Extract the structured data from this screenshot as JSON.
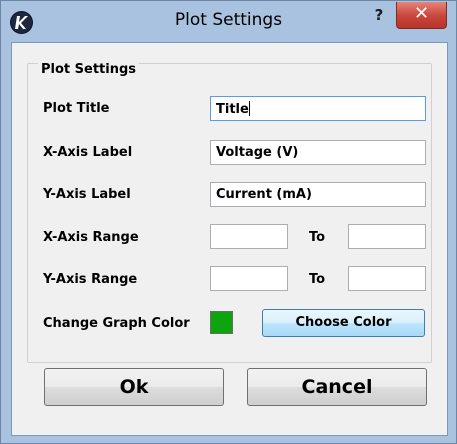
{
  "window": {
    "title": "Plot Settings",
    "help_glyph": "?",
    "close_glyph": "✕",
    "app_icon": "app-logo-icon",
    "close_color": "#c7453a"
  },
  "group": {
    "title": "Plot Settings"
  },
  "fields": {
    "plot_title": {
      "label": "Plot Title",
      "value": "Title"
    },
    "x_axis_label": {
      "label": "X-Axis Label",
      "value": "Voltage (V)"
    },
    "y_axis_label": {
      "label": "Y-Axis Label",
      "value": "Current (mA)"
    },
    "x_axis_range": {
      "label": "X-Axis Range",
      "from": "",
      "to_label": "To",
      "to": ""
    },
    "y_axis_range": {
      "label": "Y-Axis Range",
      "from": "",
      "to_label": "To",
      "to": ""
    }
  },
  "graph_color": {
    "label": "Change Graph Color",
    "value": "#0da50d",
    "button_label": "Choose Color"
  },
  "buttons": {
    "ok": "Ok",
    "cancel": "Cancel"
  }
}
